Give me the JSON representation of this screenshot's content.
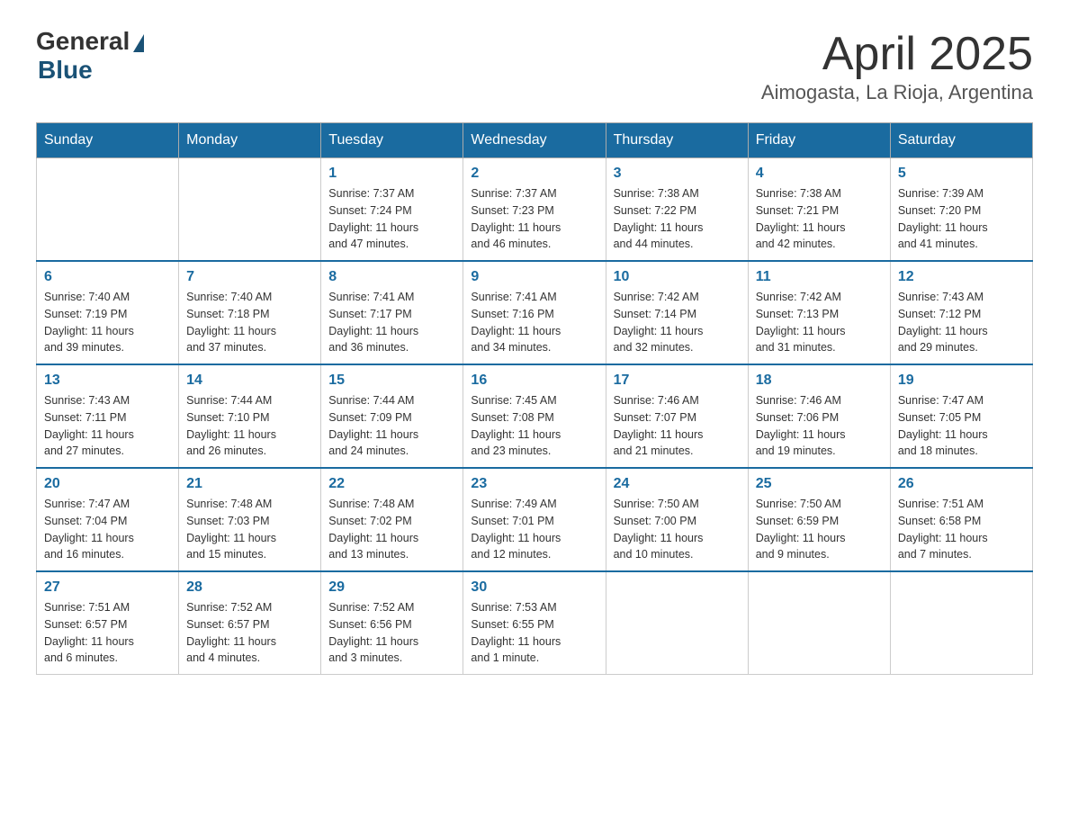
{
  "logo": {
    "general": "General",
    "blue": "Blue"
  },
  "title": "April 2025",
  "location": "Aimogasta, La Rioja, Argentina",
  "days_of_week": [
    "Sunday",
    "Monday",
    "Tuesday",
    "Wednesday",
    "Thursday",
    "Friday",
    "Saturday"
  ],
  "weeks": [
    [
      {
        "day": "",
        "info": ""
      },
      {
        "day": "",
        "info": ""
      },
      {
        "day": "1",
        "info": "Sunrise: 7:37 AM\nSunset: 7:24 PM\nDaylight: 11 hours\nand 47 minutes."
      },
      {
        "day": "2",
        "info": "Sunrise: 7:37 AM\nSunset: 7:23 PM\nDaylight: 11 hours\nand 46 minutes."
      },
      {
        "day": "3",
        "info": "Sunrise: 7:38 AM\nSunset: 7:22 PM\nDaylight: 11 hours\nand 44 minutes."
      },
      {
        "day": "4",
        "info": "Sunrise: 7:38 AM\nSunset: 7:21 PM\nDaylight: 11 hours\nand 42 minutes."
      },
      {
        "day": "5",
        "info": "Sunrise: 7:39 AM\nSunset: 7:20 PM\nDaylight: 11 hours\nand 41 minutes."
      }
    ],
    [
      {
        "day": "6",
        "info": "Sunrise: 7:40 AM\nSunset: 7:19 PM\nDaylight: 11 hours\nand 39 minutes."
      },
      {
        "day": "7",
        "info": "Sunrise: 7:40 AM\nSunset: 7:18 PM\nDaylight: 11 hours\nand 37 minutes."
      },
      {
        "day": "8",
        "info": "Sunrise: 7:41 AM\nSunset: 7:17 PM\nDaylight: 11 hours\nand 36 minutes."
      },
      {
        "day": "9",
        "info": "Sunrise: 7:41 AM\nSunset: 7:16 PM\nDaylight: 11 hours\nand 34 minutes."
      },
      {
        "day": "10",
        "info": "Sunrise: 7:42 AM\nSunset: 7:14 PM\nDaylight: 11 hours\nand 32 minutes."
      },
      {
        "day": "11",
        "info": "Sunrise: 7:42 AM\nSunset: 7:13 PM\nDaylight: 11 hours\nand 31 minutes."
      },
      {
        "day": "12",
        "info": "Sunrise: 7:43 AM\nSunset: 7:12 PM\nDaylight: 11 hours\nand 29 minutes."
      }
    ],
    [
      {
        "day": "13",
        "info": "Sunrise: 7:43 AM\nSunset: 7:11 PM\nDaylight: 11 hours\nand 27 minutes."
      },
      {
        "day": "14",
        "info": "Sunrise: 7:44 AM\nSunset: 7:10 PM\nDaylight: 11 hours\nand 26 minutes."
      },
      {
        "day": "15",
        "info": "Sunrise: 7:44 AM\nSunset: 7:09 PM\nDaylight: 11 hours\nand 24 minutes."
      },
      {
        "day": "16",
        "info": "Sunrise: 7:45 AM\nSunset: 7:08 PM\nDaylight: 11 hours\nand 23 minutes."
      },
      {
        "day": "17",
        "info": "Sunrise: 7:46 AM\nSunset: 7:07 PM\nDaylight: 11 hours\nand 21 minutes."
      },
      {
        "day": "18",
        "info": "Sunrise: 7:46 AM\nSunset: 7:06 PM\nDaylight: 11 hours\nand 19 minutes."
      },
      {
        "day": "19",
        "info": "Sunrise: 7:47 AM\nSunset: 7:05 PM\nDaylight: 11 hours\nand 18 minutes."
      }
    ],
    [
      {
        "day": "20",
        "info": "Sunrise: 7:47 AM\nSunset: 7:04 PM\nDaylight: 11 hours\nand 16 minutes."
      },
      {
        "day": "21",
        "info": "Sunrise: 7:48 AM\nSunset: 7:03 PM\nDaylight: 11 hours\nand 15 minutes."
      },
      {
        "day": "22",
        "info": "Sunrise: 7:48 AM\nSunset: 7:02 PM\nDaylight: 11 hours\nand 13 minutes."
      },
      {
        "day": "23",
        "info": "Sunrise: 7:49 AM\nSunset: 7:01 PM\nDaylight: 11 hours\nand 12 minutes."
      },
      {
        "day": "24",
        "info": "Sunrise: 7:50 AM\nSunset: 7:00 PM\nDaylight: 11 hours\nand 10 minutes."
      },
      {
        "day": "25",
        "info": "Sunrise: 7:50 AM\nSunset: 6:59 PM\nDaylight: 11 hours\nand 9 minutes."
      },
      {
        "day": "26",
        "info": "Sunrise: 7:51 AM\nSunset: 6:58 PM\nDaylight: 11 hours\nand 7 minutes."
      }
    ],
    [
      {
        "day": "27",
        "info": "Sunrise: 7:51 AM\nSunset: 6:57 PM\nDaylight: 11 hours\nand 6 minutes."
      },
      {
        "day": "28",
        "info": "Sunrise: 7:52 AM\nSunset: 6:57 PM\nDaylight: 11 hours\nand 4 minutes."
      },
      {
        "day": "29",
        "info": "Sunrise: 7:52 AM\nSunset: 6:56 PM\nDaylight: 11 hours\nand 3 minutes."
      },
      {
        "day": "30",
        "info": "Sunrise: 7:53 AM\nSunset: 6:55 PM\nDaylight: 11 hours\nand 1 minute."
      },
      {
        "day": "",
        "info": ""
      },
      {
        "day": "",
        "info": ""
      },
      {
        "day": "",
        "info": ""
      }
    ]
  ]
}
